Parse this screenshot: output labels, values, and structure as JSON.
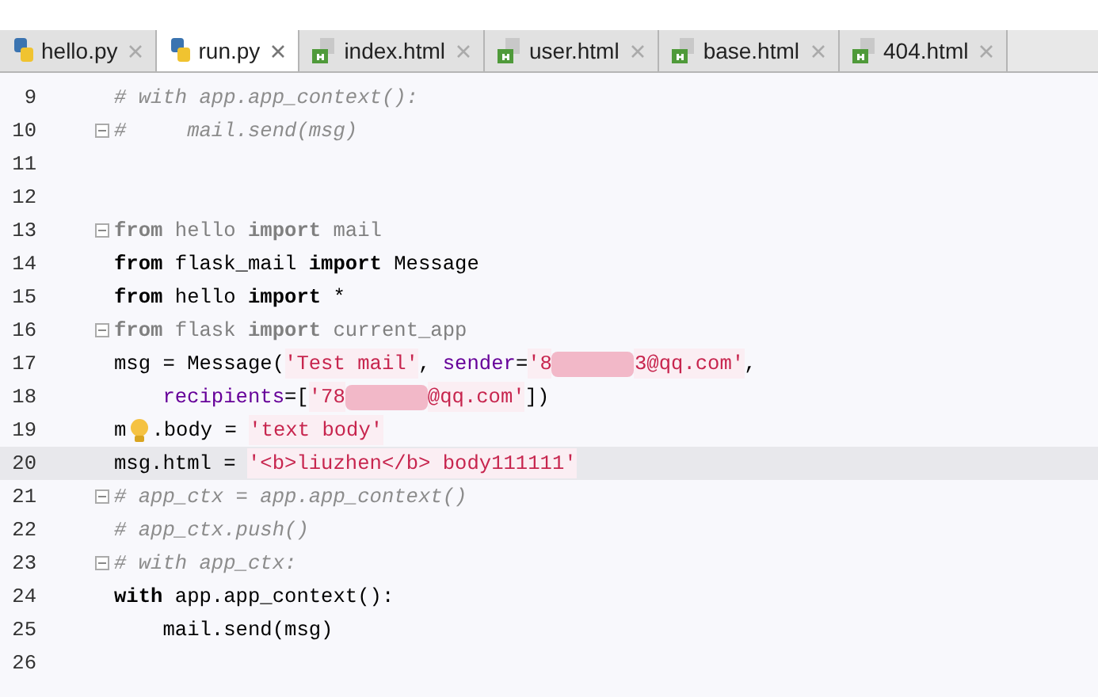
{
  "tabs": [
    {
      "label": "hello.py",
      "kind": "python",
      "selected": false
    },
    {
      "label": "run.py",
      "kind": "python",
      "selected": true
    },
    {
      "label": "index.html",
      "kind": "html",
      "selected": false
    },
    {
      "label": "user.html",
      "kind": "html",
      "selected": false
    },
    {
      "label": "base.html",
      "kind": "html",
      "selected": false
    },
    {
      "label": "404.html",
      "kind": "html",
      "selected": false
    }
  ],
  "lines": [
    {
      "number": "9",
      "fold": false,
      "current": false,
      "tokens": [
        {
          "kind": "comment",
          "text": "# with app.app_context():"
        }
      ]
    },
    {
      "number": "10",
      "fold": true,
      "current": false,
      "tokens": [
        {
          "kind": "comment",
          "text": "#     mail.send(msg)"
        }
      ]
    },
    {
      "number": "11",
      "fold": false,
      "current": false
    },
    {
      "number": "12",
      "fold": false,
      "current": false
    },
    {
      "number": "13",
      "fold": true,
      "current": false,
      "tokens": [
        {
          "kind": "dimkw",
          "text": "from"
        },
        {
          "kind": "dim",
          "text": " hello "
        },
        {
          "kind": "dimkw",
          "text": "import"
        },
        {
          "kind": "dim",
          "text": " mail"
        }
      ]
    },
    {
      "number": "14",
      "fold": false,
      "current": false,
      "tokens": [
        {
          "kind": "kw",
          "text": "from"
        },
        {
          "kind": "text",
          "text": " flask_mail "
        },
        {
          "kind": "kw",
          "text": "import"
        },
        {
          "kind": "text",
          "text": " Message"
        }
      ]
    },
    {
      "number": "15",
      "fold": false,
      "current": false,
      "tokens": [
        {
          "kind": "kw",
          "text": "from"
        },
        {
          "kind": "text",
          "text": " hello "
        },
        {
          "kind": "kw",
          "text": "import"
        },
        {
          "kind": "text",
          "text": " *"
        }
      ]
    },
    {
      "number": "16",
      "fold": true,
      "current": false,
      "tokens": [
        {
          "kind": "dimkw",
          "text": "from"
        },
        {
          "kind": "dim",
          "text": " flask "
        },
        {
          "kind": "dimkw",
          "text": "import"
        },
        {
          "kind": "dim",
          "text": " current_app"
        }
      ]
    },
    {
      "number": "17",
      "fold": false,
      "current": false,
      "tokens": [
        {
          "kind": "text",
          "text": "msg = Message("
        },
        {
          "kind": "str",
          "text": "'Test mail'"
        },
        {
          "kind": "text",
          "text": ", "
        },
        {
          "kind": "param",
          "text": "sender"
        },
        {
          "kind": "text",
          "text": "="
        },
        {
          "kind": "str",
          "text": "'8"
        },
        {
          "kind": "redact"
        },
        {
          "kind": "str",
          "text": "3@qq.com'"
        },
        {
          "kind": "text",
          "text": ","
        }
      ]
    },
    {
      "number": "18",
      "fold": false,
      "current": false,
      "tokens": [
        {
          "kind": "indent"
        },
        {
          "kind": "param",
          "text": "recipients"
        },
        {
          "kind": "text",
          "text": "=["
        },
        {
          "kind": "str",
          "text": "'78"
        },
        {
          "kind": "redact"
        },
        {
          "kind": "str",
          "text": "@qq.com'"
        },
        {
          "kind": "text",
          "text": "])"
        }
      ]
    },
    {
      "number": "19",
      "fold": false,
      "current": false,
      "tokens": [
        {
          "kind": "text",
          "text": "m"
        },
        {
          "kind": "bulb"
        },
        {
          "kind": "text",
          "text": ".body = "
        },
        {
          "kind": "str",
          "text": "'text body'"
        }
      ]
    },
    {
      "number": "20",
      "fold": false,
      "current": true,
      "tokens": [
        {
          "kind": "text",
          "text": "msg.html = "
        },
        {
          "kind": "str",
          "text": "'<b>liuzhen</b> body111111'"
        }
      ]
    },
    {
      "number": "21",
      "fold": true,
      "current": false,
      "tokens": [
        {
          "kind": "comment",
          "text": "# app_ctx = app.app_context()"
        }
      ]
    },
    {
      "number": "22",
      "fold": false,
      "current": false,
      "tokens": [
        {
          "kind": "comment",
          "text": "# app_ctx.push()"
        }
      ]
    },
    {
      "number": "23",
      "fold": true,
      "current": false,
      "tokens": [
        {
          "kind": "comment",
          "text": "# with app_ctx:"
        }
      ]
    },
    {
      "number": "24",
      "fold": false,
      "current": false,
      "tokens": [
        {
          "kind": "kw",
          "text": "with"
        },
        {
          "kind": "text",
          "text": " app.app_context():"
        }
      ]
    },
    {
      "number": "25",
      "fold": false,
      "current": false,
      "tokens": [
        {
          "kind": "text",
          "text": "    mail.send(msg)"
        }
      ]
    },
    {
      "number": "26",
      "fold": false,
      "current": false
    }
  ]
}
